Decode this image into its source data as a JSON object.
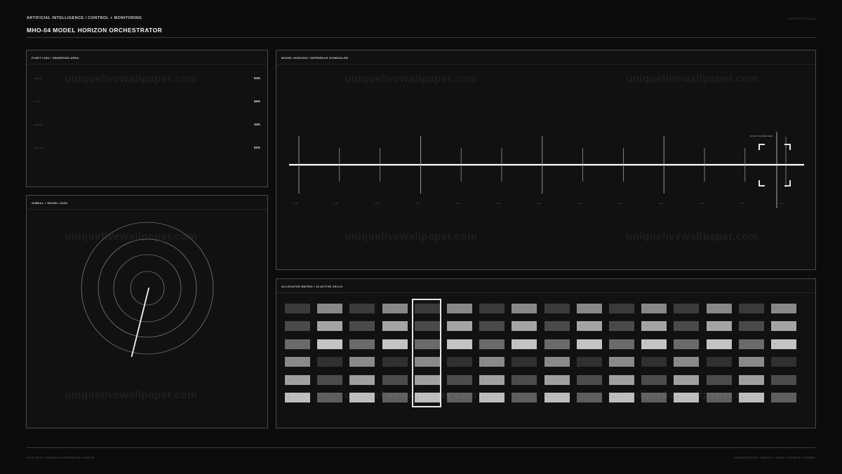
{
  "header": {
    "breadcrumb": "ARTIFICIAL INTELLIGENCE / CONTROL + MONITORING",
    "title": "MHO-04  MODEL HORIZON ORCHESTRATOR",
    "id_tag": "SUBSYSTEM 04/16"
  },
  "footer": {
    "left": "FLEET MHO / SCHEDULED INFERENCE ALLOCATION",
    "right": "INTEGRATED LINK / SAMPLE 4 / MODEL TELEMETRY CHANNEL"
  },
  "fleet_panel": {
    "title": "FLEET LINK / OBSERVED AREA",
    "metrics": [
      {
        "label": "UPLINK",
        "value": "94%"
      },
      {
        "label": "SYNC",
        "value": "65%"
      },
      {
        "label": "BUFFER",
        "value": "34%"
      },
      {
        "label": "ROUTING",
        "value": "52%"
      }
    ]
  },
  "gimbal_panel": {
    "title": "GIMBAL + MODEL LEAD",
    "ring_count": 4,
    "needle_angle_deg": 194
  },
  "horizon_panel": {
    "title": "MODEL HORIZON / INFERENCE SCHEDULER",
    "scheduler_label": "SLACK SCHEDULER",
    "tick_count": 12,
    "tick_label_text": "T+00",
    "major_ticks": [
      0,
      3,
      6,
      9
    ]
  },
  "allocator_panel": {
    "title": "ALLOCATOR MATRIX / 16 ACTIVE CELLS",
    "columns": 16,
    "rows": 6,
    "selected_column": 4,
    "row_shades": [
      [
        "#3b3b3b",
        "#888888",
        "#3b3b3b",
        "#888888",
        "#3b3b3b",
        "#888888",
        "#3b3b3b",
        "#888888",
        "#3b3b3b",
        "#888888",
        "#3b3b3b",
        "#888888",
        "#3b3b3b",
        "#888888",
        "#3b3b3b",
        "#888888"
      ],
      [
        "#4a4a4a",
        "#a5a5a5",
        "#4a4a4a",
        "#a5a5a5",
        "#4a4a4a",
        "#a5a5a5",
        "#4a4a4a",
        "#a5a5a5",
        "#4a4a4a",
        "#a5a5a5",
        "#4a4a4a",
        "#a5a5a5",
        "#4a4a4a",
        "#a5a5a5",
        "#4a4a4a",
        "#a5a5a5"
      ],
      [
        "#6a6a6a",
        "#c4c4c4",
        "#6a6a6a",
        "#c4c4c4",
        "#6a6a6a",
        "#c4c4c4",
        "#6a6a6a",
        "#c4c4c4",
        "#6a6a6a",
        "#c4c4c4",
        "#6a6a6a",
        "#c4c4c4",
        "#6a6a6a",
        "#c4c4c4",
        "#6a6a6a",
        "#c4c4c4"
      ],
      [
        "#8a8a8a",
        "#303030",
        "#8a8a8a",
        "#303030",
        "#8a8a8a",
        "#303030",
        "#8a8a8a",
        "#303030",
        "#8a8a8a",
        "#303030",
        "#8a8a8a",
        "#303030",
        "#8a8a8a",
        "#303030",
        "#8a8a8a",
        "#303030"
      ],
      [
        "#a0a0a0",
        "#4c4c4c",
        "#a0a0a0",
        "#4c4c4c",
        "#a0a0a0",
        "#4c4c4c",
        "#a0a0a0",
        "#4c4c4c",
        "#a0a0a0",
        "#4c4c4c",
        "#a0a0a0",
        "#4c4c4c",
        "#a0a0a0",
        "#4c4c4c",
        "#a0a0a0",
        "#4c4c4c"
      ],
      [
        "#bdbdbd",
        "#5e5e5e",
        "#bdbdbd",
        "#5e5e5e",
        "#bdbdbd",
        "#5e5e5e",
        "#bdbdbd",
        "#5e5e5e",
        "#bdbdbd",
        "#5e5e5e",
        "#bdbdbd",
        "#5e5e5e",
        "#bdbdbd",
        "#5e5e5e",
        "#bdbdbd",
        "#5e5e5e"
      ]
    ]
  },
  "watermark": "uniquelivewallpaper.com",
  "colors": {
    "background": "#0c0c0c",
    "panel": "#111111",
    "border": "#4a4a4a",
    "accent": "#f2f2f2"
  }
}
